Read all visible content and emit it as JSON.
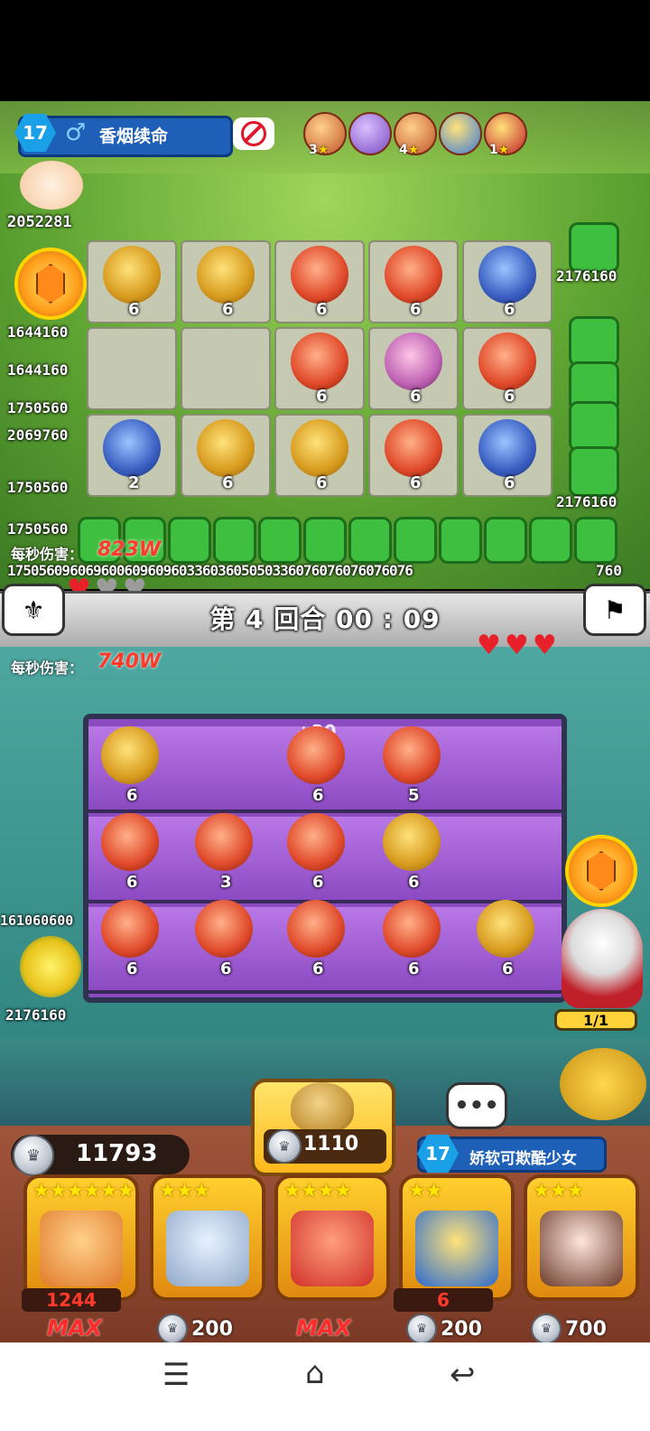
{
  "opponent": {
    "level": "17",
    "name": "香烟续命",
    "gender_icon": "male-icon",
    "total_hp": "2052281",
    "dps_label": "每秒伤害：",
    "dps_value": "823W",
    "heroes": [
      {
        "stars": "3"
      },
      {
        "stars": ""
      },
      {
        "stars": "4"
      },
      {
        "stars": ""
      },
      {
        "stars": "1"
      }
    ],
    "grid": [
      [
        "6",
        "6",
        "6",
        "6",
        "6"
      ],
      [
        "",
        "",
        "6",
        "6",
        "6"
      ],
      [
        "2",
        "6",
        "6",
        "6",
        "6"
      ]
    ],
    "left_hp": [
      "1644160",
      "1644160",
      "1750560",
      "2069760",
      "1750560",
      "1750560"
    ],
    "right_hp": [
      "2176160",
      "2176160"
    ],
    "lane_hp_row": "1750560960696006096096033603605050336076076076076076",
    "lane_hp_end": "760",
    "lives": {
      "red": 1,
      "grey": 2
    }
  },
  "round": {
    "text": "第 4 回合 00 : 09"
  },
  "player": {
    "dps_label": "每秒伤害：",
    "dps_value": "740W",
    "lives": {
      "red": 3,
      "grey": 0
    },
    "plus_bonus": "+30",
    "board": [
      [
        "6",
        "",
        "6",
        "5"
      ],
      [
        "6",
        "3",
        "6",
        "6"
      ],
      [
        "6",
        "6",
        "6",
        "6",
        "6"
      ]
    ],
    "left_hp_top": "161060600",
    "left_hp_bottom": "2176160",
    "wave_counter": "1/1",
    "coins": "11793",
    "summon_cost": "1110",
    "partner": {
      "level": "17",
      "name": "娇软可欺酷少女"
    },
    "cards": [
      {
        "stars": "★★★★★★",
        "level": "1244",
        "footer": "MAX",
        "footer_type": "max"
      },
      {
        "stars": "★★★",
        "footer": "200",
        "footer_type": "price"
      },
      {
        "stars": "★★★★",
        "footer": "MAX",
        "footer_type": "max"
      },
      {
        "stars": "★★",
        "level": "6",
        "footer": "200",
        "footer_type": "price"
      },
      {
        "stars": "★★★",
        "footer": "700",
        "footer_type": "price"
      }
    ]
  },
  "chat_icon": "•••",
  "nav": {
    "menu": "☰",
    "home": "⌂",
    "back": "↩"
  },
  "colors": {
    "dps": "#ff3a2a",
    "board": "#8c4ac2",
    "gold": "#ffd23a"
  }
}
